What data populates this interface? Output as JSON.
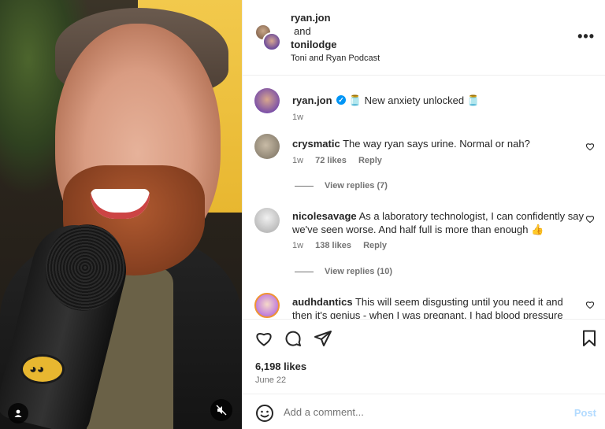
{
  "media": {
    "user_tag_icon": "person-icon",
    "mute_icon": "speaker-muted-icon"
  },
  "header": {
    "user1": "ryan.jon",
    "and": "and",
    "user2": "tonilodge",
    "subtitle": "Toni and Ryan Podcast",
    "more_icon": "more-options-icon",
    "more_label": "•••"
  },
  "caption": {
    "username": "ryan.jon",
    "text": "New anxiety unlocked",
    "time": "1w"
  },
  "comments": [
    {
      "username": "crysmatic",
      "text": "The way ryan says urine. Normal or nah?",
      "time": "1w",
      "likes": "72 likes",
      "reply": "Reply",
      "view_replies": "View replies (7)"
    },
    {
      "username": "nicolesavage",
      "text": "As a laboratory technologist, I can confidently say we've seen worse. And half full is more than enough",
      "time": "1w",
      "likes": "138 likes",
      "reply": "Reply",
      "view_replies": "View replies (10)"
    },
    {
      "username": "audhdantics",
      "text": "This will seem disgusting until you need it and then it's genius - when I was pregnant, I had blood pressure"
    }
  ],
  "actions": {
    "likes": "6,198 likes",
    "date": "June 22"
  },
  "composer": {
    "placeholder": "Add a comment...",
    "post_label": "Post"
  }
}
